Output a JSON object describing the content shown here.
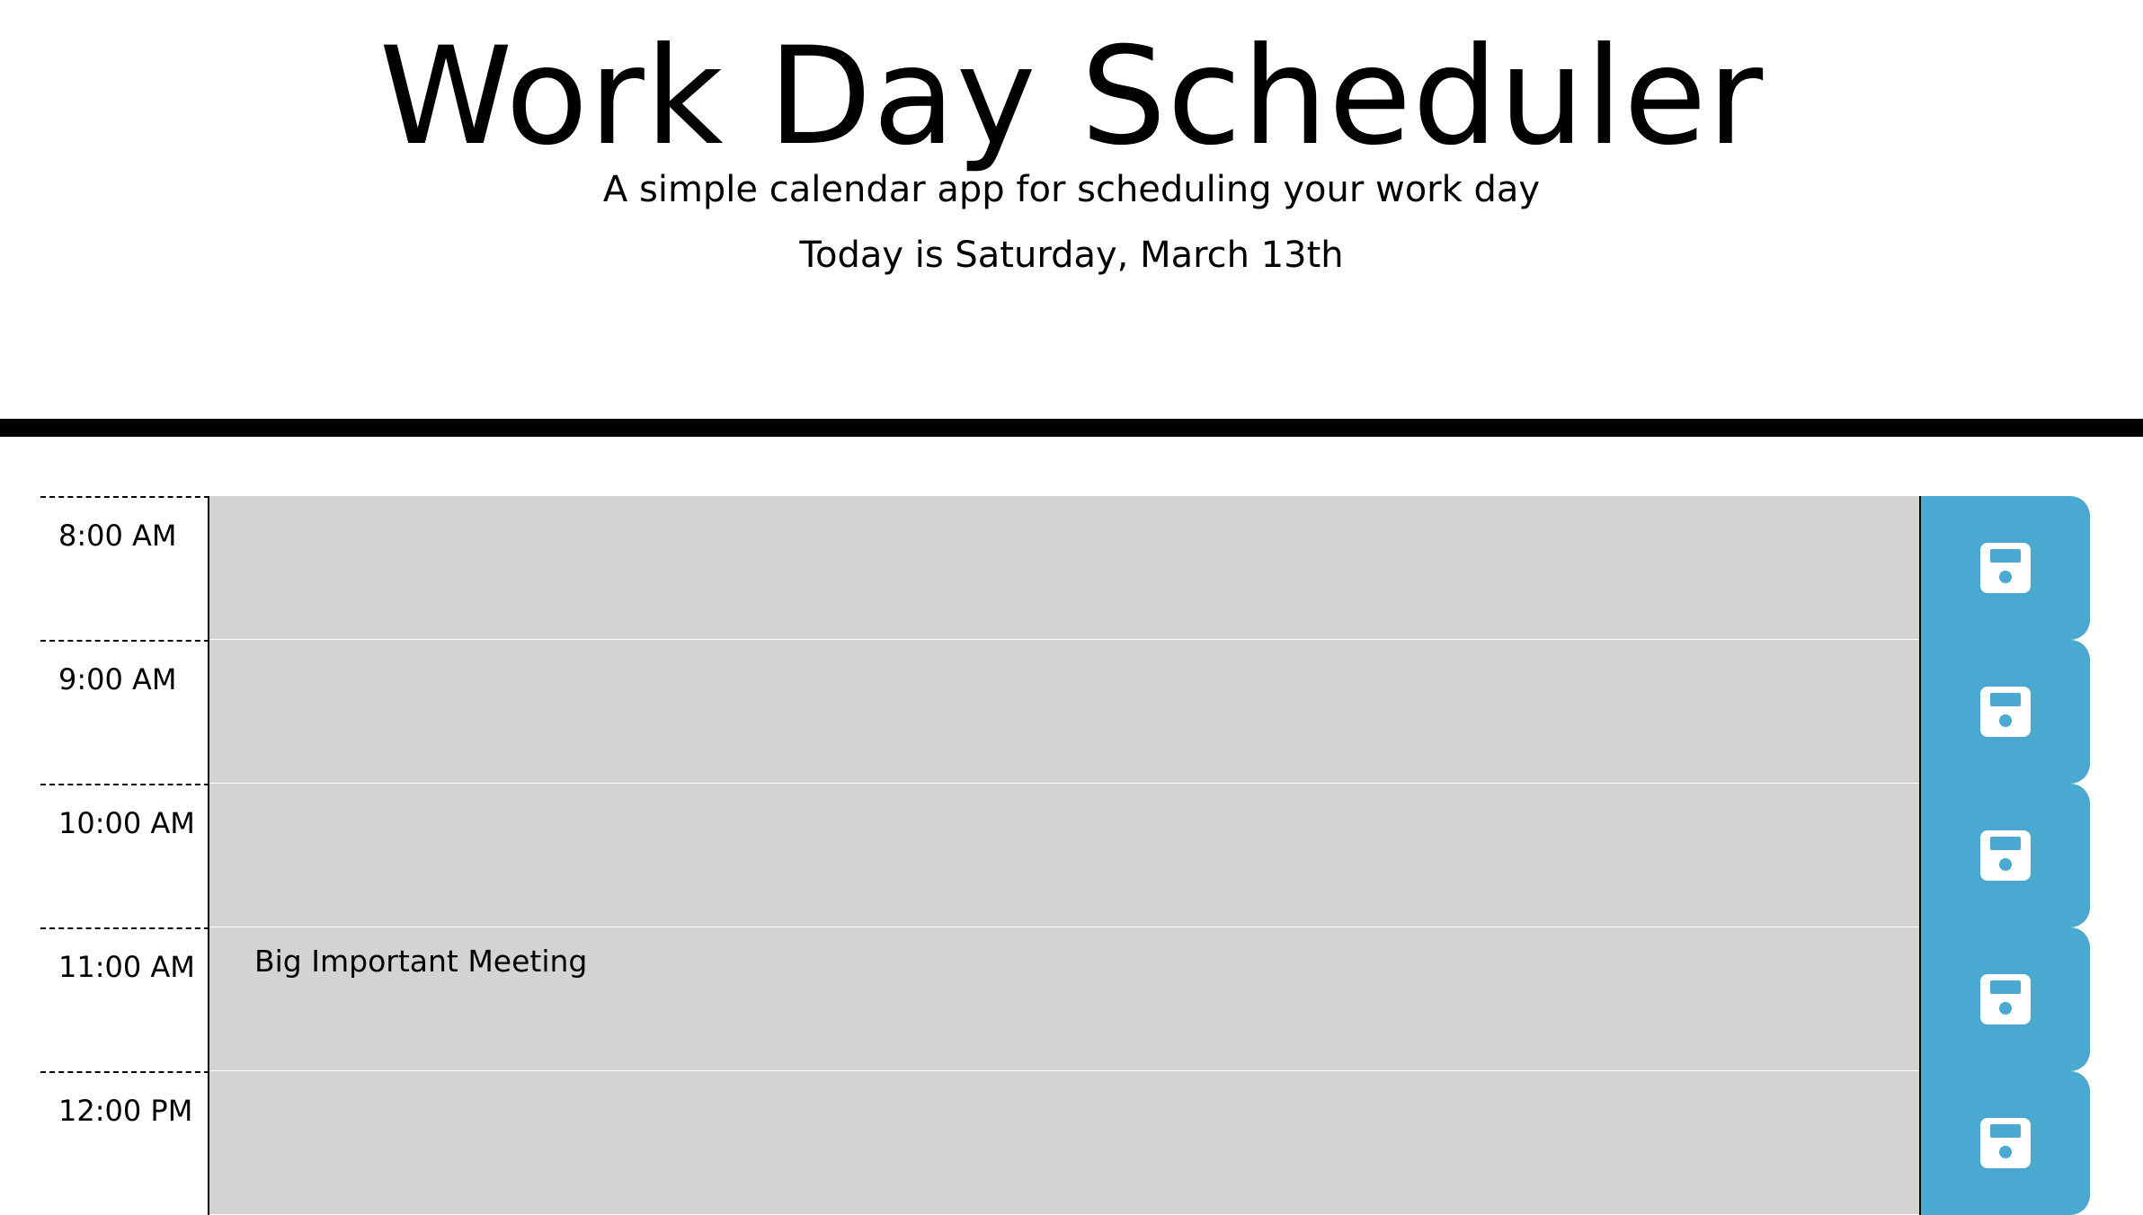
{
  "header": {
    "title": "Work Day Scheduler",
    "lead": "A simple calendar app for scheduling your work day",
    "current_day": "Today is Saturday, March 13th"
  },
  "colors": {
    "past_block": "#d3d3d3",
    "save_button": "#4ba9d1",
    "header_rule": "#000000"
  },
  "schedule": {
    "blocks": [
      {
        "hour": "8:00 AM",
        "description": "",
        "save_icon": "floppy-disk-icon"
      },
      {
        "hour": "9:00 AM",
        "description": "",
        "save_icon": "floppy-disk-icon"
      },
      {
        "hour": "10:00 AM",
        "description": "",
        "save_icon": "floppy-disk-icon"
      },
      {
        "hour": "11:00 AM",
        "description": "Big Important Meeting",
        "save_icon": "floppy-disk-icon"
      },
      {
        "hour": "12:00 PM",
        "description": "",
        "save_icon": "floppy-disk-icon"
      }
    ]
  }
}
